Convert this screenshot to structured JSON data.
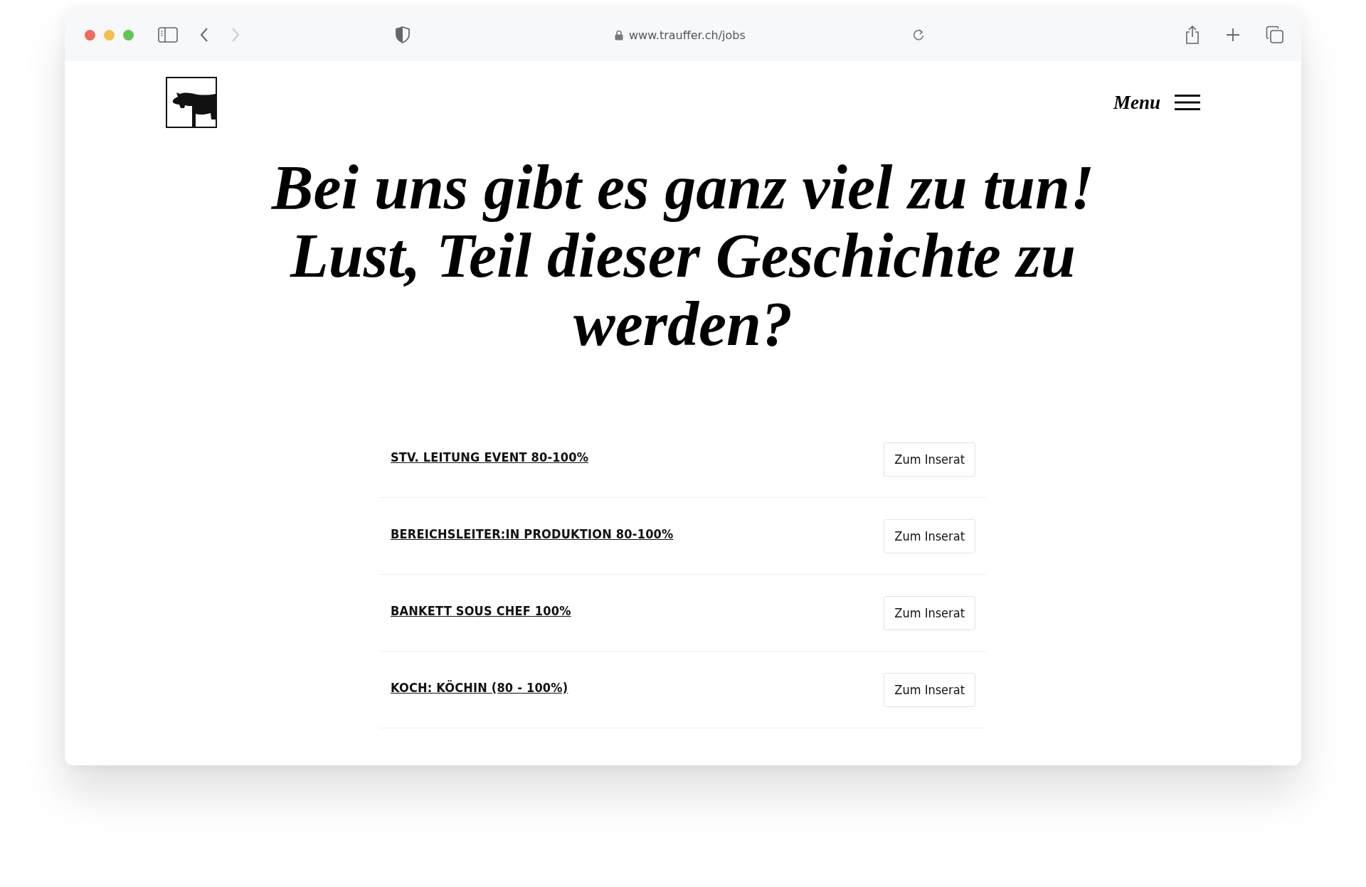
{
  "browser": {
    "url": "www.trauffer.ch/jobs"
  },
  "header": {
    "menu_label": "Menu"
  },
  "heading_lines": [
    "Bei uns gibt es ganz viel zu tun!",
    "Lust, Teil dieser Geschichte zu",
    "werden?"
  ],
  "jobs": [
    {
      "title": "STV. LEITUNG EVENT 80-100%",
      "button": "Zum Inserat"
    },
    {
      "title": "BEREICHSLEITER:IN PRODUKTION 80-100%",
      "button": "Zum Inserat"
    },
    {
      "title": "BANKETT SOUS CHEF 100%",
      "button": "Zum Inserat"
    },
    {
      "title": "KOCH: KÖCHIN (80 - 100%)",
      "button": "Zum Inserat"
    }
  ]
}
